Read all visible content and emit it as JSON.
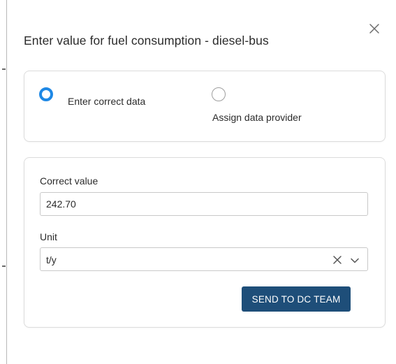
{
  "dialog": {
    "title": "Enter value for fuel consumption - diesel-bus",
    "close_icon": "close-icon"
  },
  "options": {
    "selected": "enter_correct_data",
    "enter_correct_data_label": "Enter correct data",
    "assign_data_provider_label": "Assign data provider"
  },
  "form": {
    "correct_value_label": "Correct value",
    "correct_value": "242.70",
    "unit_label": "Unit",
    "unit_value": "t/y",
    "clear_icon": "clear-icon",
    "dropdown_icon": "chevron-down-icon",
    "submit_label": "SEND TO DC TEAM"
  },
  "colors": {
    "accent": "#1e88e5",
    "button": "#1e4e79",
    "border": "#dcdcdc",
    "text": "#2b2b2b"
  }
}
